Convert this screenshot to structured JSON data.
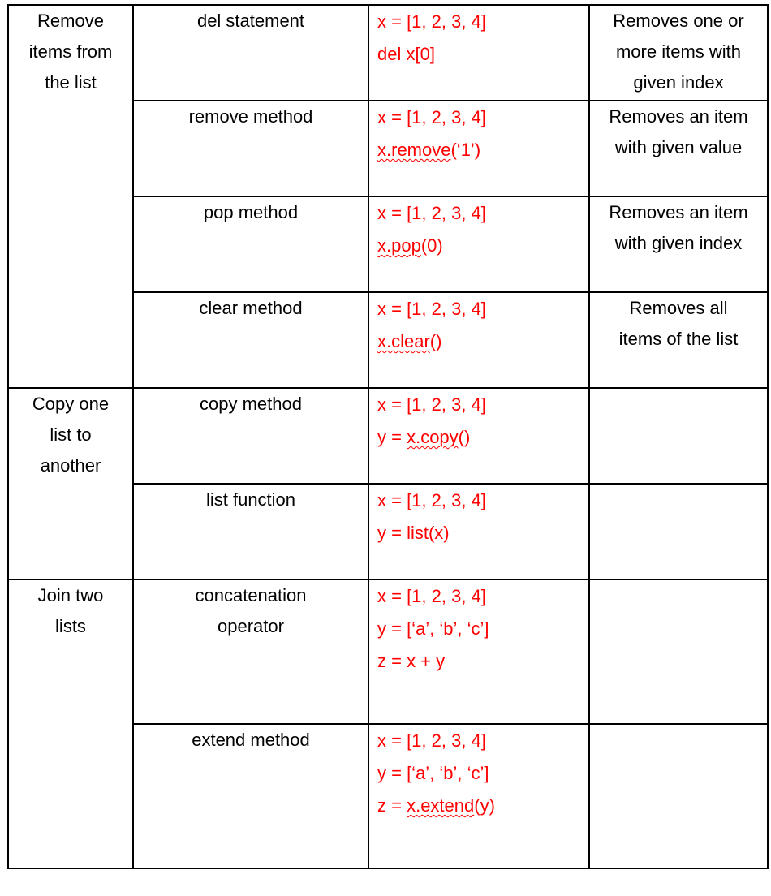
{
  "table": {
    "groups": [
      {
        "category": "Remove items from the list",
        "category_lines": [
          "Remove",
          "items from",
          "the list"
        ],
        "rows": [
          {
            "method_lines": [
              "del statement"
            ],
            "code": [
              {
                "pre": "x = [1, 2, 3, 4]",
                "spell": "",
                "post": ""
              },
              {
                "pre": "del x[0]",
                "spell": "",
                "post": ""
              }
            ],
            "desc_lines": [
              "Removes one or",
              "more items with",
              "given index"
            ]
          },
          {
            "method_lines": [
              "remove method"
            ],
            "code": [
              {
                "pre": "x = [1, 2, 3, 4]",
                "spell": "",
                "post": ""
              },
              {
                "pre": "",
                "spell": "x.remove",
                "post": "(‘1’)"
              }
            ],
            "desc_lines": [
              "Removes an item",
              "with given value"
            ]
          },
          {
            "method_lines": [
              "pop method"
            ],
            "code": [
              {
                "pre": "x = [1, 2, 3, 4]",
                "spell": "",
                "post": ""
              },
              {
                "pre": "",
                "spell": "x.pop",
                "post": "(0)"
              }
            ],
            "desc_lines": [
              "Removes an item",
              "with given index"
            ]
          },
          {
            "method_lines": [
              "clear method"
            ],
            "code": [
              {
                "pre": "x = [1, 2, 3, 4]",
                "spell": "",
                "post": ""
              },
              {
                "pre": "",
                "spell": "x.clear",
                "post": "()"
              }
            ],
            "desc_lines": [
              "Removes all",
              "items of the list"
            ]
          }
        ]
      },
      {
        "category": "Copy one list to another",
        "category_lines": [
          "Copy one",
          "list to",
          "another"
        ],
        "rows": [
          {
            "method_lines": [
              "copy method"
            ],
            "code": [
              {
                "pre": "x = [1, 2, 3, 4]",
                "spell": "",
                "post": ""
              },
              {
                "pre": "y = ",
                "spell": "x.copy",
                "post": "()"
              }
            ],
            "desc_lines": []
          },
          {
            "method_lines": [
              "list function"
            ],
            "code": [
              {
                "pre": "x = [1, 2, 3, 4]",
                "spell": "",
                "post": ""
              },
              {
                "pre": "y = list(x)",
                "spell": "",
                "post": ""
              }
            ],
            "desc_lines": []
          }
        ]
      },
      {
        "category": "Join two lists",
        "category_lines": [
          "Join two",
          "lists"
        ],
        "rows": [
          {
            "method_lines": [
              "concatenation",
              "operator"
            ],
            "code": [
              {
                "pre": "x = [1, 2, 3, 4]",
                "spell": "",
                "post": ""
              },
              {
                "pre": "y = [‘a’, ‘b’, ‘c’]",
                "spell": "",
                "post": ""
              },
              {
                "pre": "z = x + y",
                "spell": "",
                "post": ""
              }
            ],
            "desc_lines": []
          },
          {
            "method_lines": [
              "extend method"
            ],
            "code": [
              {
                "pre": "x = [1, 2, 3, 4]",
                "spell": "",
                "post": ""
              },
              {
                "pre": "y = [‘a’, ‘b’, ‘c’]",
                "spell": "",
                "post": ""
              },
              {
                "pre": "z = ",
                "spell": "x.extend",
                "post": "(y)"
              }
            ],
            "desc_lines": []
          }
        ]
      }
    ]
  },
  "colors": {
    "code_text": "#FF0000",
    "text": "#000000",
    "border": "#000000"
  }
}
